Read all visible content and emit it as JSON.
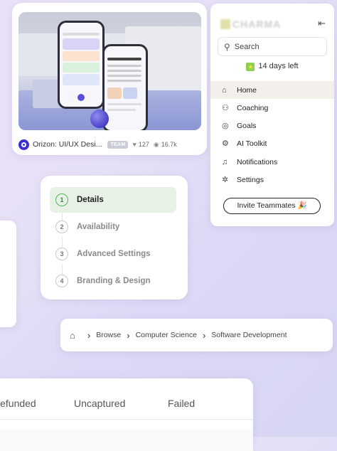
{
  "shot": {
    "title": "Orizon: UI/UX Desi...",
    "badge": "TEAM",
    "likes": "127",
    "views": "16.7k",
    "colors": {
      "avatar": "#3b2fd1",
      "sphere": "#4a3fc7"
    }
  },
  "sidebar": {
    "logo": "CHARMA",
    "search_label": "Search",
    "trial": "14 days left",
    "items": [
      {
        "label": "Home",
        "icon": "home-icon",
        "active": true
      },
      {
        "label": "Coaching",
        "icon": "coaching-icon"
      },
      {
        "label": "Goals",
        "icon": "goals-icon"
      },
      {
        "label": "AI Toolkit",
        "icon": "robot-icon"
      },
      {
        "label": "Notifications",
        "icon": "bell-icon"
      },
      {
        "label": "Settings",
        "icon": "gear-icon"
      }
    ],
    "invite": "Invite Teammates 🎉",
    "active_bg": "#f3efea"
  },
  "steps": [
    {
      "num": "1",
      "label": "Details",
      "active": true
    },
    {
      "num": "2",
      "label": "Availability"
    },
    {
      "num": "3",
      "label": "Advanced Settings"
    },
    {
      "num": "4",
      "label": "Branding & Design"
    }
  ],
  "breadcrumb": [
    "Browse",
    "Computer Science",
    "Software Development"
  ],
  "tabs": [
    "Refunded",
    "Uncaptured",
    "Failed"
  ]
}
